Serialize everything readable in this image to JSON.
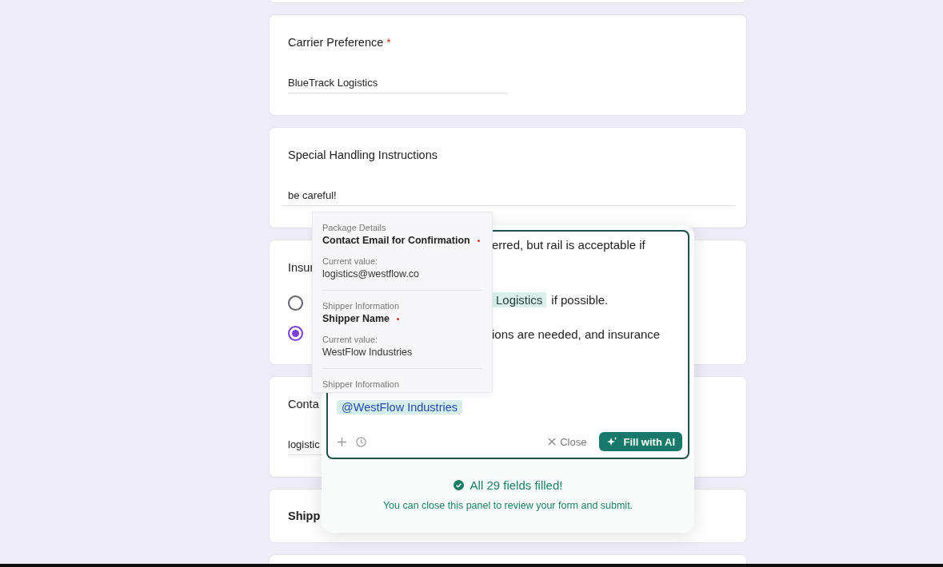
{
  "form": {
    "cards": [
      {
        "kind": "text",
        "label": "Carrier Preference",
        "required_mark": "*",
        "value": "BlueTrack Logistics",
        "wide": false
      },
      {
        "kind": "text",
        "label": "Special Handling Instructions",
        "value": "be careful!",
        "wide": true
      },
      {
        "kind": "radio",
        "label": "Insur",
        "options": [
          {
            "selected": false
          },
          {
            "selected": true
          }
        ]
      },
      {
        "kind": "text",
        "label": "Conta",
        "value": "logistic",
        "wide": false
      },
      {
        "kind": "heading",
        "label": "Shipp"
      }
    ]
  },
  "panel": {
    "editor": {
      "lines": [
        [
          {
            "kind": "text",
            "text": "erred, but rail is acceptable if"
          }
        ],
        [
          {
            "kind": "chip",
            "text": "Logistics"
          },
          {
            "kind": "text",
            "text": "if possible."
          }
        ],
        [
          {
            "kind": "text",
            "text": "ions are needed, and insurance"
          }
        ]
      ],
      "mention": "@WestFlow Industries",
      "close": "Close",
      "fill_button": "Fill with AI"
    },
    "status": {
      "title": "All 29 fields filled!",
      "message": "You can close this panel to review your form and submit."
    }
  },
  "suggestions": [
    {
      "group": "Package Details",
      "field": "Contact Email for Confirmation",
      "required": true,
      "value_label": "Current value:",
      "value": "logistics@westflow.co"
    },
    {
      "group": "Shipper Information",
      "field": "Shipper Name",
      "required": true,
      "value_label": "Current value:",
      "value": "WestFlow Industries"
    },
    {
      "group": "Shipper Information"
    }
  ]
}
